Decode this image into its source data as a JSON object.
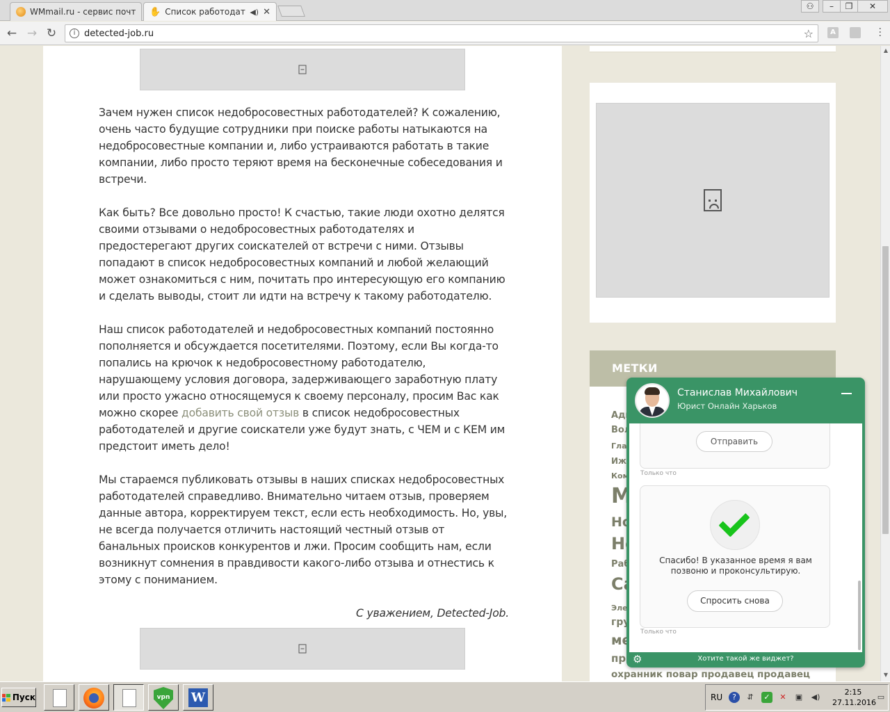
{
  "browser": {
    "tabs": [
      {
        "title": "WMmail.ru - сервис почтов"
      },
      {
        "title": "Список работодателей"
      }
    ],
    "url": "detected-job.ru"
  },
  "article": {
    "p1": "Зачем нужен список недобросовестных работодателей? К сожалению, очень часто будущие сотрудники при поиске работы натыкаются на недобросовестные компании и, либо устраиваются работать в такие компании, либо просто теряют время на бесконечные собеседования и встречи.",
    "p2": "Как быть? Все довольно просто! К счастью, такие люди охотно делятся своими отзывами о недобросовестных работодателях и предостерегают других соискателей от встречи с ними. Отзывы попадают в список недобросовестных компаний и любой желающий может ознакомиться с ним, почитать про интересующую его компанию и сделать выводы, стоит ли идти на встречу к такому работодателю.",
    "p3_before": "Наш список работодателей и недобросовестных компаний постоянно пополняется и обсуждается посетителями. Поэтому, если Вы когда-то попались на крючок к недобросовестному работодателю, нарушающему условия договора, задерживающего заработную плату или просто ужасно относящемуся к своему персоналу, просим Вас как можно скорее ",
    "p3_link": "добавить свой отзыв",
    "p3_after": " в список недобросовестных работодателей и другие соискатели уже будут знать, с ЧЕМ и с КЕМ им предстоит иметь дело!",
    "p4": "Мы стараемся публиковать отзывы в наших списках недобросовестных работодателей справедливо. Внимательно читаем отзыв, проверяем данные автора, корректируем текст, если есть необходимость. Но, увы, не всегда получается отличить настоящий честный отзыв от банальных происков конкурентов и лжи. Просим сообщить нам, если возникнут сомнения в правдивости какого-либо отзыва и отнестись к этому с пониманием.",
    "signature": "С уважением, Detected-Job."
  },
  "sidebar": {
    "tags_title": "МЕТКИ",
    "tags": [
      "Адм",
      "Вол",
      "Гла",
      "Иж",
      "Ком",
      "М",
      "Но",
      "Не",
      "Раб",
      "Са",
      "Эле",
      "гру",
      "ме",
      "пр"
    ],
    "tags_bottom": "охранник повар продавец продавец"
  },
  "chat": {
    "name": "Станислав Михайлович",
    "subtitle": "Юрист Онлайн Харьков",
    "send_button": "Отправить",
    "time1": "Только что",
    "thanks": "Спасибо! В указанное время я вам позвоню и проконсультирую.",
    "ask_again_button": "Спросить снова",
    "time2": "Только что",
    "footer_link": "Хотите такой же виджет?"
  },
  "taskbar": {
    "start": "Пуск",
    "vpn_label": "vpn",
    "word_label": "W",
    "lang": "RU",
    "time": "2:15",
    "date": "27.11.2016"
  },
  "colors": {
    "chat_green": "#3a9466",
    "tags_header": "#bdbea7",
    "link": "#8b8f7a",
    "check": "#18c41b"
  }
}
